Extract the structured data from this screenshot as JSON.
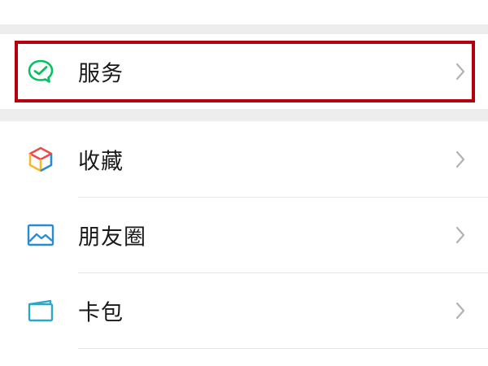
{
  "menu": {
    "items": [
      {
        "label": "服务",
        "icon": "services-icon",
        "color": "#07c160"
      },
      {
        "label": "收藏",
        "icon": "favorites-cube-icon",
        "color": "#f5a623"
      },
      {
        "label": "朋友圈",
        "icon": "moments-picture-icon",
        "color": "#2a8bd5"
      },
      {
        "label": "卡包",
        "icon": "card-wallet-icon",
        "color": "#2aa7c9"
      }
    ]
  },
  "highlight": {
    "color": "#b3000c",
    "target": "服务"
  }
}
